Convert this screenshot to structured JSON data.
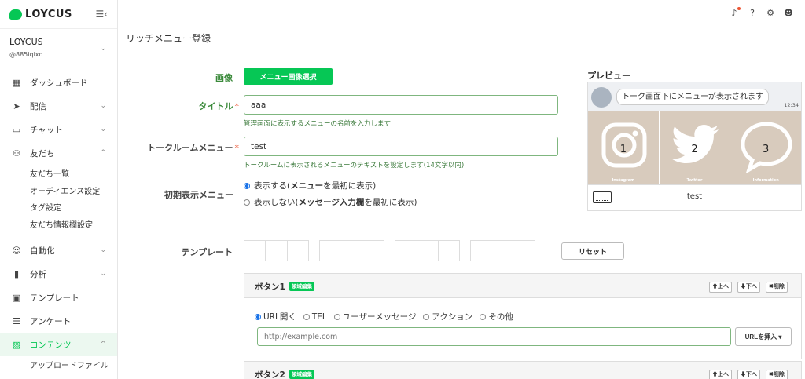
{
  "sidebar": {
    "logo": "LOYCUS",
    "account_name": "LOYCUS",
    "account_id": "@885iqixd",
    "items": [
      {
        "label": "ダッシュボード",
        "icon": "dashboard-icon",
        "glyph": "▦"
      },
      {
        "label": "配信",
        "icon": "send-icon",
        "glyph": "➤"
      },
      {
        "label": "チャット",
        "icon": "chat-icon",
        "glyph": "▭"
      },
      {
        "label": "友だち",
        "icon": "friends-icon",
        "glyph": "⚇"
      },
      {
        "label": "自動化",
        "icon": "robot-icon",
        "glyph": "☺"
      },
      {
        "label": "分析",
        "icon": "analytics-icon",
        "glyph": "▮"
      },
      {
        "label": "テンプレート",
        "icon": "template-icon",
        "glyph": "▣"
      },
      {
        "label": "アンケート",
        "icon": "survey-icon",
        "glyph": "☰"
      },
      {
        "label": "コンテンツ",
        "icon": "image-icon",
        "glyph": "▨"
      }
    ],
    "friends_sub": [
      "友だち一覧",
      "オーディエンス設定",
      "タグ設定",
      "友だち情報欄設定"
    ],
    "contents_sub": [
      "アップロードファイル"
    ]
  },
  "page": {
    "title": "リッチメニュー登録"
  },
  "form": {
    "image_label": "画像",
    "image_button": "メニュー画像選択",
    "title_label": "タイトル",
    "title_value": "aaa",
    "title_help": "管理画面に表示するメニューの名前を入力します",
    "chatroom_label": "トークルームメニュー",
    "chatroom_value": "test",
    "chatroom_help": "トークルームに表示されるメニューのテキストを設定します(14文字以内)",
    "required_mark": "*",
    "initial_label": "初期表示メニュー",
    "initial_options": [
      {
        "prefix": "表示する(",
        "bold": "メニュー",
        "suffix": "を最初に表示)",
        "selected": true
      },
      {
        "prefix": "表示しない(",
        "bold": "メッセージ入力欄",
        "suffix": "を最初に表示)",
        "selected": false
      }
    ],
    "template_label": "テンプレート",
    "reset_button": "リセット"
  },
  "preview": {
    "title": "プレビュー",
    "bubble": "トーク画面下にメニューが表示されます",
    "time": "12:34",
    "cells": [
      {
        "num": "1",
        "caption": "Instagram",
        "icon": "instagram-icon"
      },
      {
        "num": "2",
        "caption": "Twitter",
        "icon": "twitter-icon"
      },
      {
        "num": "3",
        "caption": "Information",
        "icon": "speech-bubble-icon"
      }
    ],
    "menu_text": "test"
  },
  "buttons": [
    {
      "title": "ボタン1",
      "badge": "領域編集",
      "up": "⬆上へ",
      "down": "⬇下へ",
      "delete": "✖削除",
      "types": [
        "URL開く",
        "TEL",
        "ユーザーメッセージ",
        "アクション",
        "その他"
      ],
      "selected_type": 0,
      "url_placeholder": "http://example.com",
      "insert_button": "URLを挿入 ▾"
    },
    {
      "title": "ボタン2",
      "badge": "領域編集",
      "up": "⬆上へ",
      "down": "⬇下へ",
      "delete": "✖削除"
    }
  ],
  "colors": {
    "accent": "#06c755",
    "label_green": "#3b8a3b",
    "preview_cell": "#d8cbbd"
  }
}
